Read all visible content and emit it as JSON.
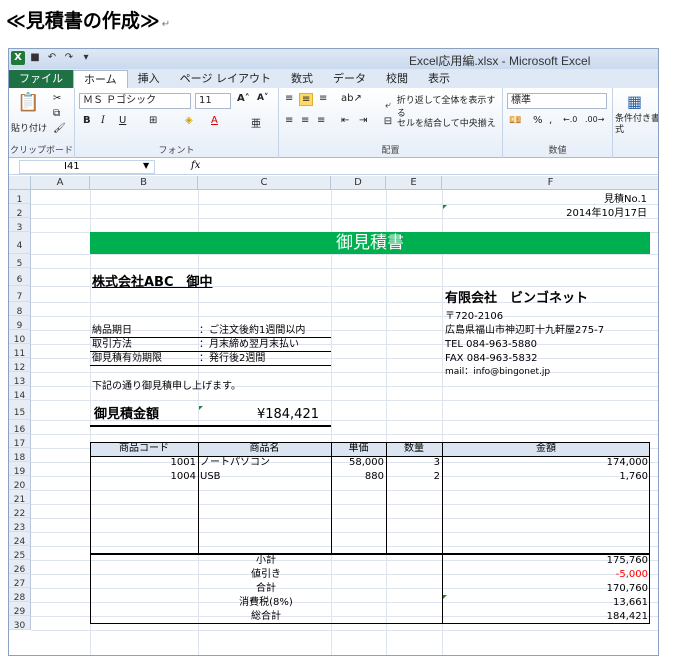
{
  "heading": {
    "text": "≪見積書の作成≫",
    "return_mark": "↵"
  },
  "window": {
    "title": "Excel応用編.xlsx - Microsoft Excel"
  },
  "tabs": [
    "ファイル",
    "ホーム",
    "挿入",
    "ページ レイアウト",
    "数式",
    "データ",
    "校閲",
    "表示"
  ],
  "ribbon": {
    "clipboard": {
      "paste_label": "貼り付け",
      "group_label": "クリップボード"
    },
    "font": {
      "font_name": "ＭＳ Ｐゴシック",
      "font_size": "11",
      "group_label": "フォント"
    },
    "alignment": {
      "wrap_text": "折り返して全体を表示する",
      "merge_center": "セルを結合して中央揃え",
      "group_label": "配置"
    },
    "number": {
      "format": "標準",
      "group_label": "数値"
    },
    "styles": {
      "conditional": "条件付き書式"
    }
  },
  "formula_bar": {
    "name_box": "I41",
    "fx": "fx"
  },
  "columns": [
    "A",
    "B",
    "C",
    "D",
    "E",
    "F"
  ],
  "rows": [
    "1",
    "2",
    "3",
    "4",
    "5",
    "6",
    "7",
    "8",
    "9",
    "10",
    "11",
    "12",
    "13",
    "14",
    "15",
    "16",
    "17",
    "18",
    "19",
    "20",
    "21",
    "22",
    "23",
    "24",
    "25",
    "26",
    "27",
    "28",
    "29",
    "30"
  ],
  "sheet": {
    "quote_no": "見積No.1",
    "date": "2014年10月17日",
    "title": "御見積書",
    "customer": "株式会社ABC　御中",
    "company": "有限会社　ビンゴネット",
    "postal": "〒720-2106",
    "address": "広島県福山市神辺町十九軒屋275-7",
    "tel": "TEL  084-963-5880",
    "fax": "FAX  084-963-5832",
    "mail": "mail：info@bingonet.jp",
    "terms": [
      {
        "label": "納品期日",
        "value": "：ご注文後約1週間以内"
      },
      {
        "label": "取引方法",
        "value": "：月末締め翌月末払い"
      },
      {
        "label": "御見積有効期限",
        "value": "：発行後2週間"
      }
    ],
    "intro": "下記の通り御見積申し上げます。",
    "total_label": "御見積金額",
    "total_value": "¥184,421",
    "table_headers": {
      "code": "商品コード",
      "name": "商品名",
      "price": "単価",
      "qty": "数量",
      "amount": "金額"
    },
    "items": [
      {
        "code": "1001",
        "name": "ノートパソコン",
        "price": "58,000",
        "qty": "3",
        "amount": "174,000"
      },
      {
        "code": "1004",
        "name": "USB",
        "price": "880",
        "qty": "2",
        "amount": "1,760"
      }
    ],
    "summary": [
      {
        "label": "小計",
        "value": "175,760"
      },
      {
        "label": "値引き",
        "value": "-5,000"
      },
      {
        "label": "合計",
        "value": "170,760"
      },
      {
        "label": "消費税(8%)",
        "value": "13,661"
      },
      {
        "label": "総合計",
        "value": "184,421"
      }
    ]
  },
  "colors": {
    "banner": "#00b050",
    "header_fill": "#dbe5f1",
    "negative": "#ff0000",
    "file_tab": "#1e7145"
  }
}
